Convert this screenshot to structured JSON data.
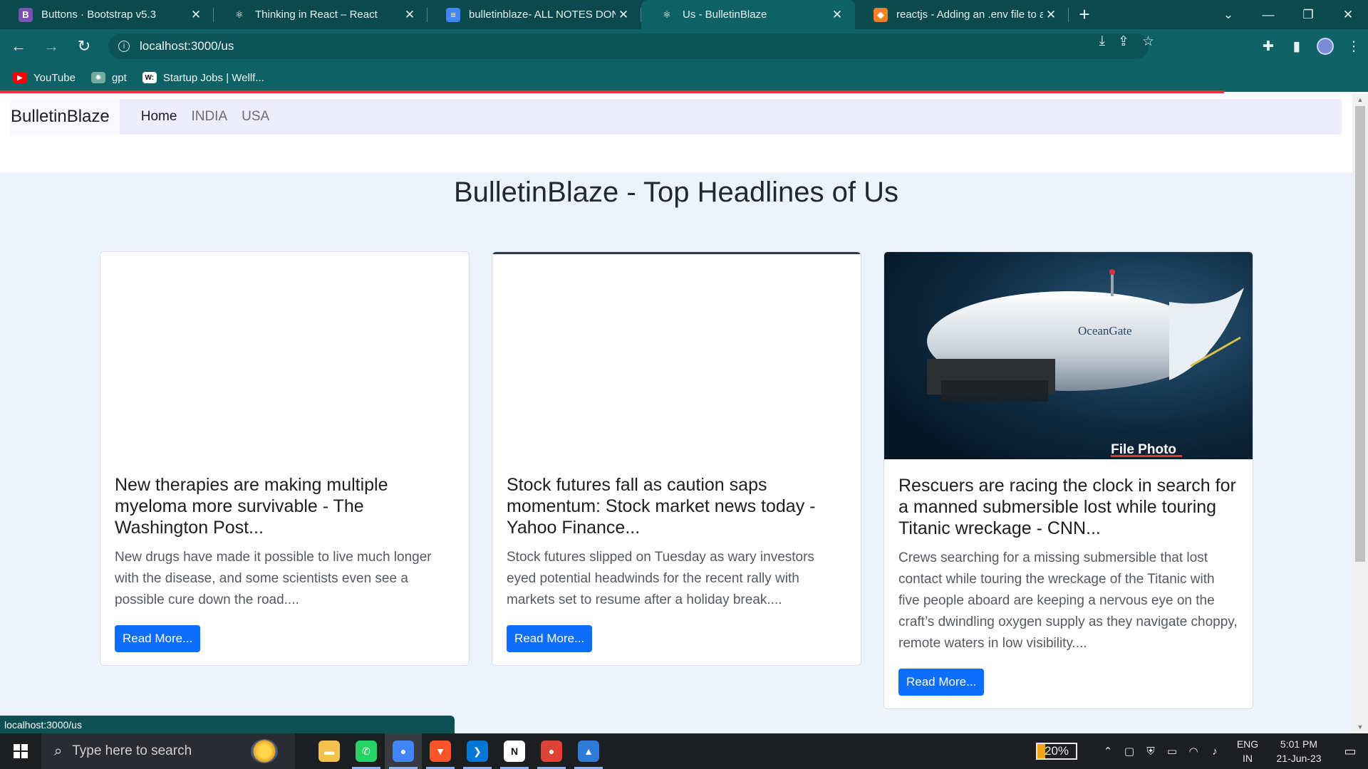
{
  "browser": {
    "tabs": [
      {
        "title": "Buttons · Bootstrap v5.3",
        "favicon": "B",
        "color": "#7952b3"
      },
      {
        "title": "Thinking in React – React",
        "favicon": "⚛",
        "color": "#0a4a4d"
      },
      {
        "title": "bulletinblaze- ALL NOTES DONE!",
        "favicon": "≡",
        "color": "#4285f4"
      },
      {
        "title": "Us - BulletinBlaze",
        "favicon": "⚛",
        "color": "#0e6164"
      },
      {
        "title": "reactjs - Adding an .env file to a R",
        "favicon": "◆",
        "color": "#f48024"
      }
    ],
    "active_tab": 3,
    "close_glyph": "✕",
    "newtab_glyph": "+",
    "url": "localhost:3000/us",
    "bookmarks": [
      {
        "label": "YouTube",
        "icon": "youtube-icon",
        "color": "#ff0000",
        "glyph": "▶"
      },
      {
        "label": "gpt",
        "icon": "openai-icon",
        "color": "#74aa9c",
        "glyph": "✺"
      },
      {
        "label": "Startup Jobs | Wellf...",
        "icon": "wellfound-icon",
        "color": "#ffffff",
        "glyph": "W:"
      }
    ],
    "status_url": "localhost:3000/us"
  },
  "site": {
    "brand": "BulletinBlaze",
    "nav": [
      {
        "label": "Home",
        "active": true
      },
      {
        "label": "INDIA",
        "active": false
      },
      {
        "label": "USA",
        "active": false
      }
    ],
    "heading": "BulletinBlaze - Top Headlines of Us",
    "cards": [
      {
        "title": "New therapies are making multiple myeloma more survivable - The Washington Post...",
        "description": "New drugs have made it possible to live much longer with the disease, and some scientists even see a possible cure down the road....",
        "button": "Read More...",
        "image": "blank"
      },
      {
        "title": "Stock futures fall as caution saps momentum: Stock market news today - Yahoo Finance...",
        "description": "Stock futures slipped on Tuesday as wary investors eyed potential headwinds for the recent rally with markets set to resume after a holiday break....",
        "button": "Read More...",
        "image": "blank"
      },
      {
        "title": "Rescuers are racing the clock in search for a manned submersible lost while touring Titanic wreckage - CNN...",
        "description": "Crews searching for a missing submersible that lost contact while touring the wreckage of the Titanic with five people aboard are keeping a nervous eye on the craft’s dwindling oxygen supply as they navigate choppy, remote waters in low visibility....",
        "button": "Read More...",
        "image": "submersible",
        "image_caption": "File Photo",
        "image_brand": "OceanGate"
      }
    ]
  },
  "taskbar": {
    "search_placeholder": "Type here to search",
    "battery": "20%",
    "battery_level": 0.2,
    "lang_top": "ENG",
    "lang_bottom": "IN",
    "time": "5:01 PM",
    "date": "21-Jun-23",
    "apps": [
      {
        "name": "file-explorer-icon",
        "color": "#f2c14e",
        "glyph": "▬"
      },
      {
        "name": "whatsapp-icon",
        "color": "#25d366",
        "glyph": "✆"
      },
      {
        "name": "chrome-icon",
        "color": "#4285f4",
        "glyph": "●"
      },
      {
        "name": "brave-icon",
        "color": "#fb542b",
        "glyph": "▼"
      },
      {
        "name": "vscode-icon",
        "color": "#0078d4",
        "glyph": "❯"
      },
      {
        "name": "notion-icon",
        "color": "#ffffff",
        "glyph": "N"
      },
      {
        "name": "chrome-profile-icon",
        "color": "#db4437",
        "glyph": "●"
      },
      {
        "name": "photos-icon",
        "color": "#2f7bd8",
        "glyph": "▲"
      }
    ]
  }
}
